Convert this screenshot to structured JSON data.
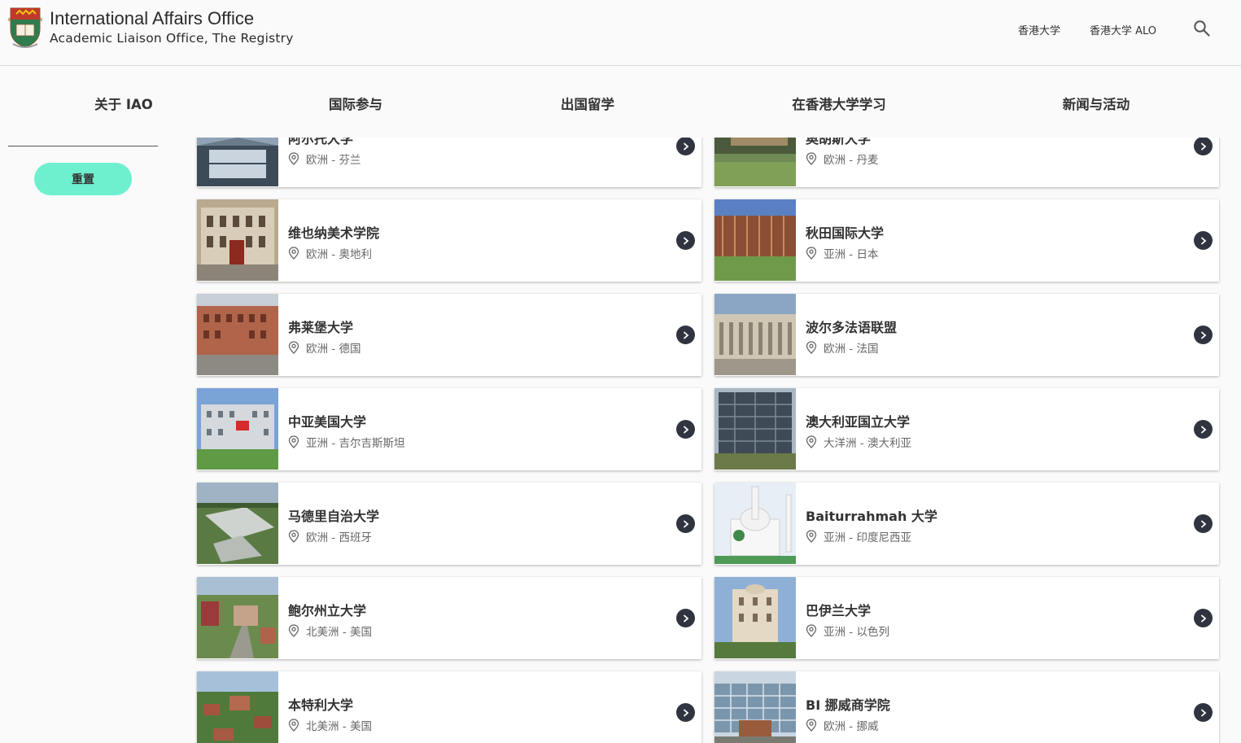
{
  "header": {
    "title": "International Affairs Office",
    "subtitle": "Academic Liaison Office, The Registry",
    "util_links": [
      "香港大学",
      "香港大学 ALO"
    ],
    "search_icon": "search-icon"
  },
  "nav": {
    "items": [
      "关于 IAO",
      "国际参与",
      "出国留学",
      "在香港大学学习",
      "新闻与活动"
    ]
  },
  "sidebar": {
    "reset_label": "重置",
    "accent": "#6ef0cf"
  },
  "cards": [
    {
      "title": "阿尔托大学",
      "location": "欧洲 - 芬兰"
    },
    {
      "title": "奥胡斯大学",
      "location": "欧洲 - 丹麦"
    },
    {
      "title": "维也纳美术学院",
      "location": "欧洲 - 奥地利"
    },
    {
      "title": "秋田国际大学",
      "location": "亚洲 - 日本"
    },
    {
      "title": "弗莱堡大学",
      "location": "欧洲 - 德国"
    },
    {
      "title": "波尔多法语联盟",
      "location": "欧洲 - 法国"
    },
    {
      "title": "中亚美国大学",
      "location": "亚洲 - 吉尔吉斯斯坦"
    },
    {
      "title": "澳大利亚国立大学",
      "location": "大洋洲 - 澳大利亚"
    },
    {
      "title": "马德里自治大学",
      "location": "欧洲 - 西班牙"
    },
    {
      "title": "Baiturrahmah 大学",
      "location": "亚洲 - 印度尼西亚"
    },
    {
      "title": "鲍尔州立大学",
      "location": "北美洲 - 美国"
    },
    {
      "title": "巴伊兰大学",
      "location": "亚洲 - 以色列"
    },
    {
      "title": "本特利大学",
      "location": "北美洲 - 美国"
    },
    {
      "title": "BI 挪威商学院",
      "location": "欧洲 - 挪威"
    }
  ]
}
